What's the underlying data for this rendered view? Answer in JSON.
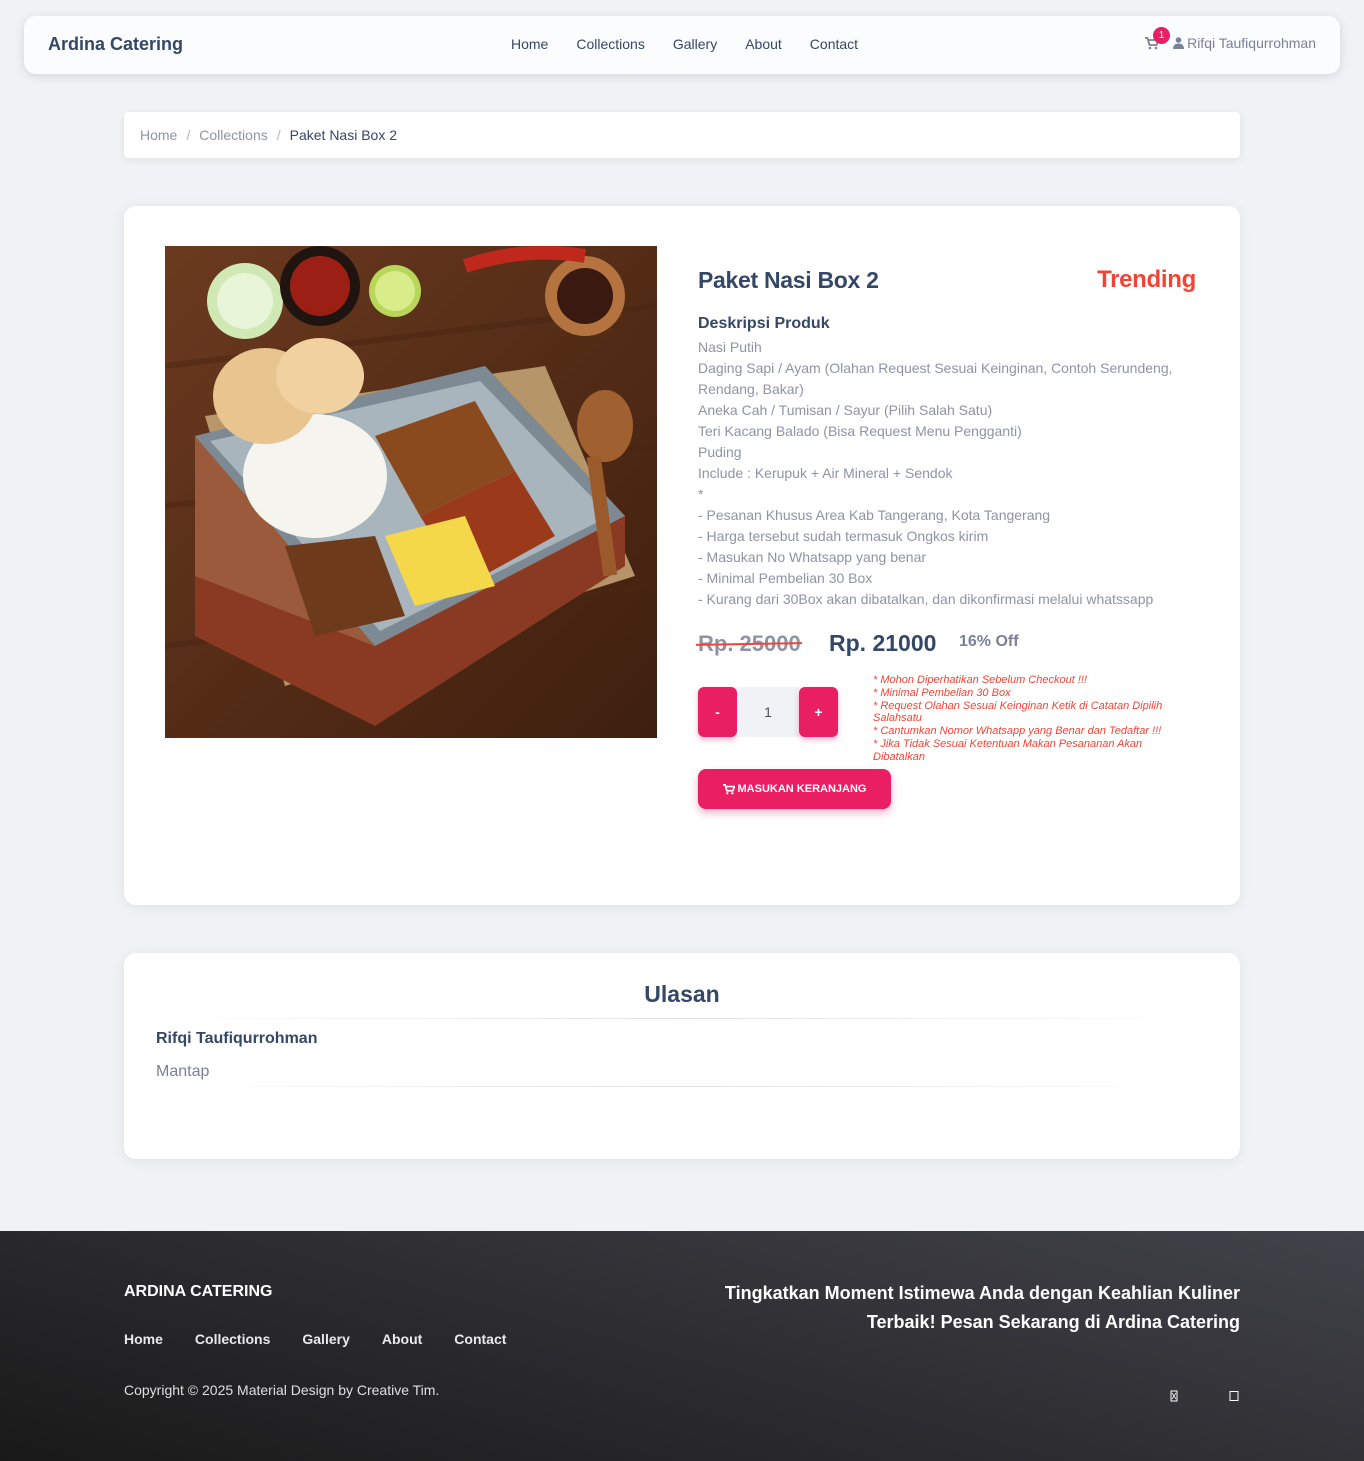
{
  "navbar": {
    "brand": "Ardina Catering",
    "links": [
      "Home",
      "Collections",
      "Gallery",
      "About",
      "Contact"
    ],
    "cart_count": "1",
    "user_name": "Rifqi Taufiqurrohman"
  },
  "breadcrumb": {
    "home": "Home",
    "collections": "Collections",
    "current": "Paket Nasi Box 2",
    "separator": "/"
  },
  "product": {
    "title": "Paket Nasi Box 2",
    "badge": "Trending",
    "desc_heading": "Deskripsi Produk",
    "description": [
      "Nasi Putih",
      "Daging Sapi / Ayam (Olahan Request Sesuai Keinginan, Contoh Serundeng, Rendang, Bakar)",
      "Aneka Cah / Tumisan / Sayur (Pilih Salah Satu)",
      "Teri Kacang Balado (Bisa Request Menu Pengganti)",
      "Puding",
      "Include : Kerupuk + Air Mineral + Sendok",
      "*",
      "- Pesanan Khusus Area Kab Tangerang, Kota Tangerang",
      "- Harga tersebut sudah termasuk Ongkos kirim",
      "- Masukan No Whatsapp yang benar",
      "- Minimal Pembelian 30 Box",
      "- Kurang dari 30Box akan dibatalkan, dan dikonfirmasi melalui whatssapp"
    ],
    "price_old": "Rp. 25000",
    "price_new": "Rp. 21000",
    "discount": "16% Off",
    "qty_minus": "-",
    "qty_value": "1",
    "qty_plus": "+",
    "notes": [
      "* Mohon Diperhatikan Sebelum Checkout !!!",
      "* Minimal Pembelian 30 Box",
      "* Request Olahan Sesuai Keinginan Ketik di Catatan Dipilih Salahsatu",
      "* Cantumkan Nomor Whatsapp yang Benar dan Tedaftar !!!",
      "* Jika Tidak Sesuai Ketentuan Makan Pesananan Akan Dibatalkan"
    ],
    "add_to_cart": "MASUKAN KERANJANG"
  },
  "reviews": {
    "title": "Ulasan",
    "items": [
      {
        "name": "Rifqi Taufiqurrohman",
        "text": "Mantap"
      }
    ]
  },
  "footer": {
    "brand": "ARDINA CATERING",
    "links": [
      "Home",
      "Collections",
      "Gallery",
      "About",
      "Contact"
    ],
    "copyright": "Copyright © 2025 Material Design by Creative Tim.",
    "tagline": "Tingkatkan Moment Istimewa Anda dengan Keahlian Kuliner Terbaik! Pesan Sekarang di Ardina Catering",
    "social_icons": [
      "instagram-icon",
      "facebook-icon"
    ]
  },
  "colors": {
    "primary": "#e91e63",
    "danger": "#f44335",
    "dark": "#344767",
    "muted": "#8f93a6"
  }
}
